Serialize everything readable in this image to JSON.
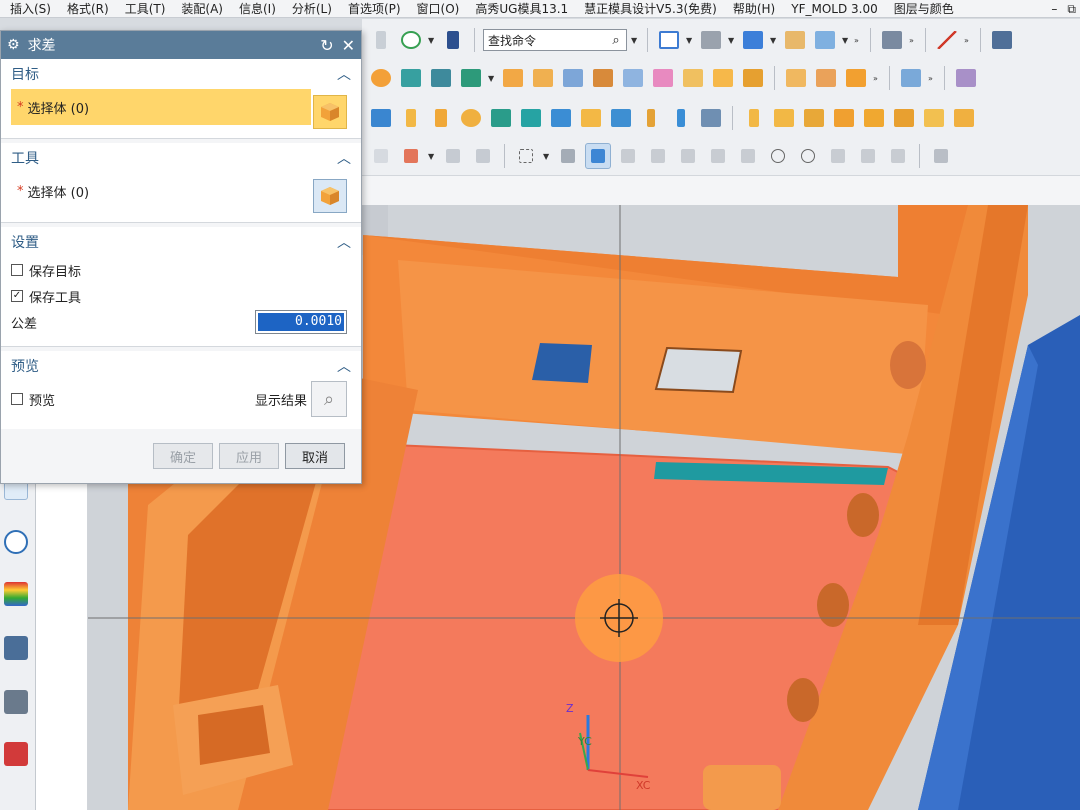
{
  "menu": {
    "items": [
      "插入(S)",
      "格式(R)",
      "工具(T)",
      "装配(A)",
      "信息(I)",
      "分析(L)",
      "首选项(P)",
      "窗口(O)",
      "高秀UG模具13.1",
      "慧正模具设计V5.3(免费)",
      "帮助(H)",
      "YF_MOLD 3.00",
      "图层与颜色"
    ],
    "window_controls": [
      "–",
      "⧉"
    ]
  },
  "toolbar": {
    "search_placeholder": "查找命令",
    "search_icon": "magnifier-icon"
  },
  "dialog": {
    "title": "求差",
    "title_icons": [
      "gear-icon",
      "reset-icon",
      "close-icon"
    ],
    "sections": {
      "target": {
        "header": "目标",
        "select_label": "选择体 (0)"
      },
      "tool": {
        "header": "工具",
        "select_label": "选择体 (0)"
      },
      "settings": {
        "header": "设置",
        "keep_target_label": "保存目标",
        "keep_target_checked": false,
        "keep_tool_label": "保存工具",
        "keep_tool_checked": true,
        "tolerance_label": "公差",
        "tolerance_value": "0.0010"
      },
      "preview": {
        "header": "预览",
        "preview_label": "预览",
        "preview_checked": false,
        "show_result_label": "显示结果"
      }
    },
    "buttons": {
      "ok": "确定",
      "apply": "应用",
      "cancel": "取消"
    }
  },
  "viewport": {
    "axis_labels": {
      "z": "Z",
      "y": "YC",
      "x": "XC"
    },
    "colors": {
      "part_orange": "#f08a3a",
      "face_highlight": "#f47a5c",
      "blue_part": "#2a5fb8",
      "background": "#cfd3d8"
    }
  },
  "colors": {
    "dialog_title_bar": "#5a7c99",
    "section_header": "#2f5d86",
    "highlight_row": "#ffd66b",
    "selection": "#1d64c4",
    "required_star": "#d53a1f"
  }
}
